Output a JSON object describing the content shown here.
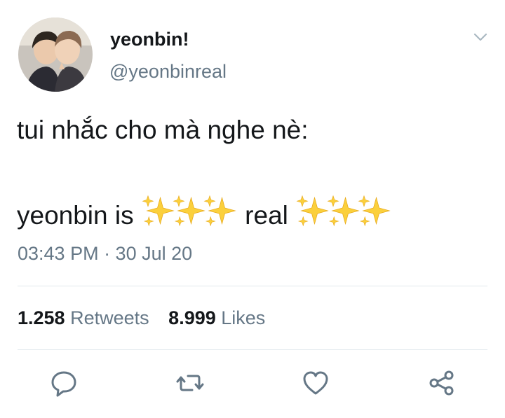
{
  "tweet": {
    "display_name": "yeonbin!",
    "handle": "@yeonbinreal",
    "line1": "tui nhắc cho mà nghe nè:",
    "line2_part1": "yeonbin is",
    "line2_part2": "real",
    "timestamp": "03:43 PM · 30 Jul 20"
  },
  "stats": {
    "retweets_count": "1.258",
    "retweets_label": "Retweets",
    "likes_count": "8.999",
    "likes_label": "Likes"
  },
  "icons": {
    "menu": "chevron-down-icon",
    "reply": "reply-icon",
    "retweet": "retweet-icon",
    "like": "heart-icon",
    "share": "share-icon",
    "emoji": "sparkles-emoji"
  },
  "colors": {
    "text_primary": "#14171a",
    "text_secondary": "#657786",
    "divider": "#e1e8ed",
    "sparkle": "#f5c518"
  }
}
